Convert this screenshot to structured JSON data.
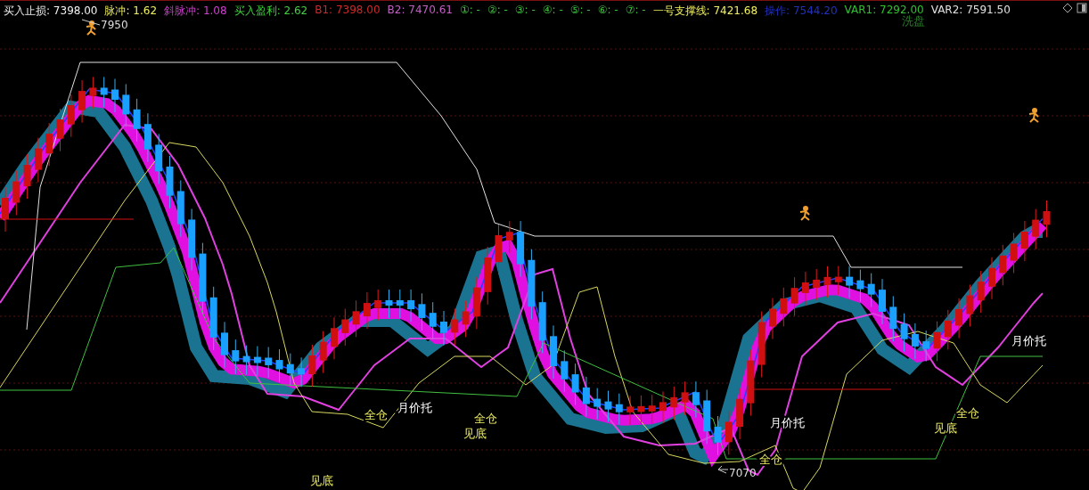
{
  "header": [
    {
      "text": "买入止损: 7398.00",
      "color": "#f0f0f0"
    },
    {
      "text": "脉冲: 1.62",
      "color": "#f0f060"
    },
    {
      "text": "斜脉冲: 1.08",
      "color": "#d040d0"
    },
    {
      "text": "买入盈利: 2.62",
      "color": "#40d040"
    },
    {
      "text": "B1: 7398.00",
      "color": "#d02828"
    },
    {
      "text": "B2: 7470.61",
      "color": "#c060c0"
    },
    {
      "text": "①: -",
      "color": "#40c040"
    },
    {
      "text": "②: -",
      "color": "#40c040"
    },
    {
      "text": "③: -",
      "color": "#40c040"
    },
    {
      "text": "④: -",
      "color": "#40c040"
    },
    {
      "text": "⑤: -",
      "color": "#40c040"
    },
    {
      "text": "⑥: -",
      "color": "#40c040"
    },
    {
      "text": "⑦: -",
      "color": "#40c040"
    },
    {
      "text": "一号支撑线: 7421.68",
      "color": "#f0f060"
    },
    {
      "text": "操作: 7544.20",
      "color": "#2030c0"
    },
    {
      "text": "VAR1: 7292.00",
      "color": "#30c030"
    },
    {
      "text": "VAR2: 7591.50",
      "color": "#e0e0e0"
    }
  ],
  "price_marks": [
    {
      "text": "7950",
      "kind": "high"
    },
    {
      "text": "7070",
      "kind": "low"
    }
  ],
  "signals": [
    {
      "text": "洗盘",
      "kind": "wash"
    },
    {
      "text": "全仓",
      "kind": "full"
    },
    {
      "text": "月价托",
      "kind": "support"
    },
    {
      "text": "全仓",
      "kind": "full"
    },
    {
      "text": "见底",
      "kind": "bottom"
    },
    {
      "text": "月价托",
      "kind": "support"
    },
    {
      "text": "全仓",
      "kind": "full"
    },
    {
      "text": "见底",
      "kind": "bottom"
    },
    {
      "text": "全仓",
      "kind": "full"
    },
    {
      "text": "月价托",
      "kind": "support"
    },
    {
      "text": "见底",
      "kind": "bottom"
    }
  ]
}
